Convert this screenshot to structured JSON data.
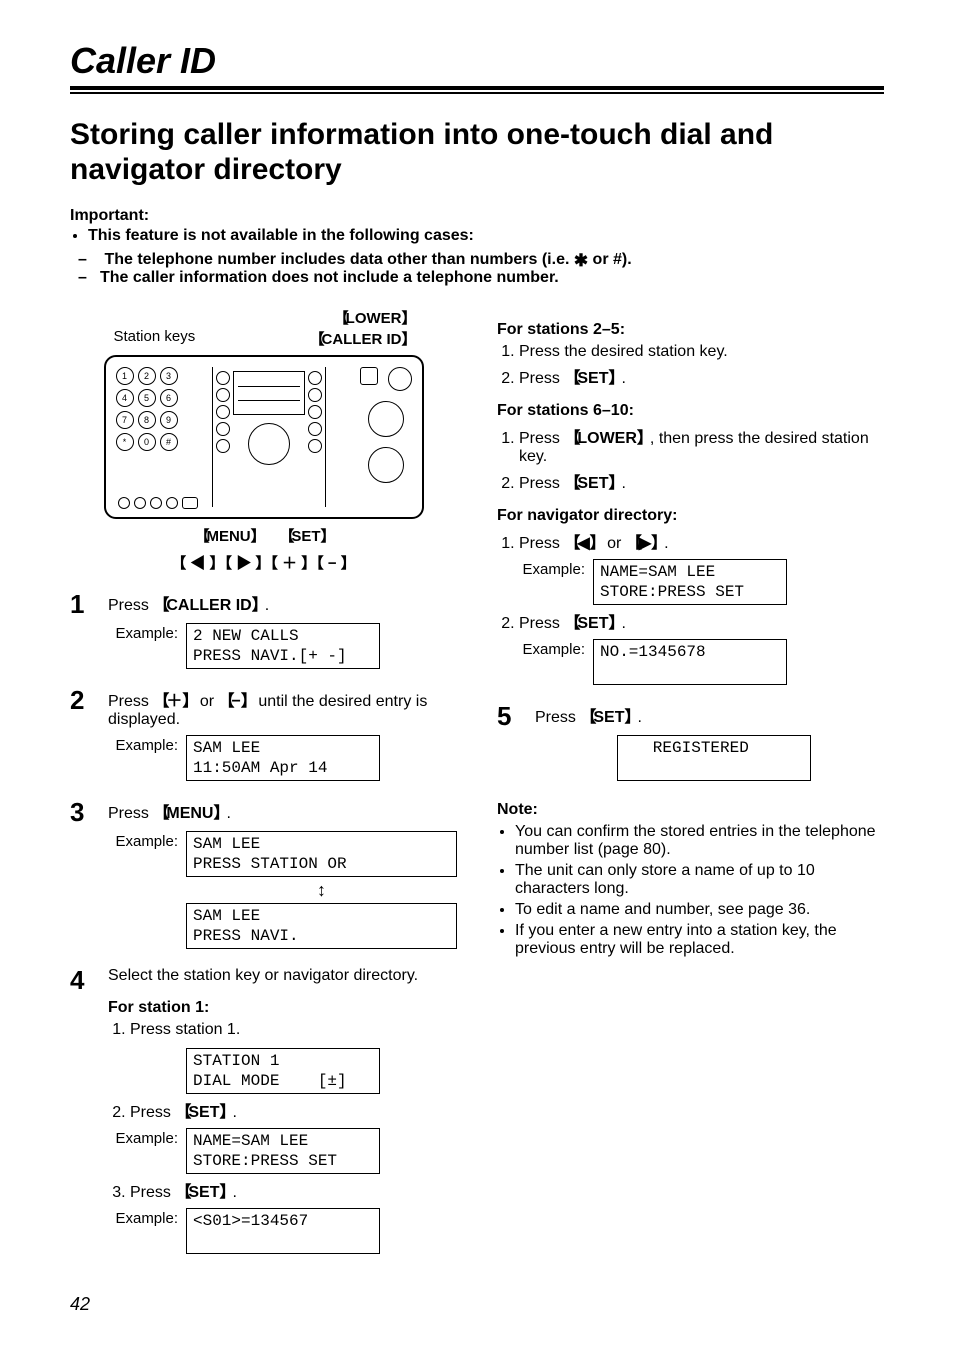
{
  "header": {
    "section_title": "Caller ID",
    "heading": "Storing caller information into one-touch dial and navigator directory"
  },
  "important": {
    "label": "Important:",
    "bullet": "This feature is not available in the following cases:",
    "dash1_pre": "The telephone number includes data other than numbers (i.e. ",
    "dash1_post": " or #).",
    "dash2": "The caller information does not include a telephone number."
  },
  "diagram": {
    "lower": "LOWER",
    "station_keys": "Station keys",
    "caller_id": "CALLER ID",
    "menu": "MENU",
    "set": "SET",
    "nav_icons": "【 ◀ 】【 ▶ 】【 ＋ 】【 − 】",
    "kp": [
      "1",
      "2",
      "3",
      "4",
      "5",
      "6",
      "7",
      "8",
      "9",
      "*",
      "0",
      "#"
    ]
  },
  "steps": {
    "s1": {
      "text_pre": "Press ",
      "key": "CALLER ID",
      "text_post": ".",
      "example_label": "Example:",
      "display": "2 NEW CALLS\nPRESS NAVI.[+ -]"
    },
    "s2": {
      "text_pre": "Press ",
      "key1": "＋",
      "mid": " or ",
      "key2": "−",
      "text_post": " until the desired entry is displayed.",
      "example_label": "Example:",
      "display": "SAM LEE\n11:50AM Apr 14"
    },
    "s3": {
      "text_pre": "Press ",
      "key": "MENU",
      "text_post": ".",
      "example_label": "Example:",
      "display1": "SAM LEE\nPRESS STATION OR",
      "display2": "SAM LEE\nPRESS NAVI."
    },
    "s4": {
      "text": "Select the station key or navigator directory.",
      "for_station1": "For station 1:",
      "st1_1": "Press station 1.",
      "display1": "STATION 1\nDIAL MODE    [±]",
      "st1_2_pre": "Press ",
      "st1_2_key": "SET",
      "st1_2_post": ".",
      "example_label": "Example:",
      "display2": "NAME=SAM LEE\nSTORE:PRESS SET",
      "st1_3_pre": "Press ",
      "st1_3_key": "SET",
      "st1_3_post": ".",
      "display3": "<S01>=134567\n "
    },
    "s5": {
      "text_pre": "Press ",
      "key": "SET",
      "text_post": ".",
      "display": "   REGISTERED\n "
    }
  },
  "right": {
    "st25": {
      "head": "For stations 2–5:",
      "l1": "Press the desired station key.",
      "l2_pre": "Press ",
      "l2_key": "SET",
      "l2_post": "."
    },
    "st610": {
      "head": "For stations 6–10:",
      "l1_pre": "Press ",
      "l1_key": "LOWER",
      "l1_post": ", then press the desired station key.",
      "l2_pre": "Press ",
      "l2_key": "SET",
      "l2_post": "."
    },
    "nav": {
      "head": "For navigator directory:",
      "l1_pre": "Press ",
      "l1_k1": "◀",
      "l1_mid": " or ",
      "l1_k2": "▶",
      "l1_post": ".",
      "example_label": "Example:",
      "display1": "NAME=SAM LEE\nSTORE:PRESS SET",
      "l2_pre": "Press ",
      "l2_key": "SET",
      "l2_post": ".",
      "display2": "NO.=1345678\n "
    },
    "note": {
      "head": "Note:",
      "n1": "You can confirm the stored entries in the telephone number list (page 80).",
      "n2": "The unit can only store a name of up to 10 characters long.",
      "n3": "To edit a name and number, see page 36.",
      "n4": "If you enter a new entry into a station key, the previous entry will be replaced."
    }
  },
  "page_number": "42"
}
